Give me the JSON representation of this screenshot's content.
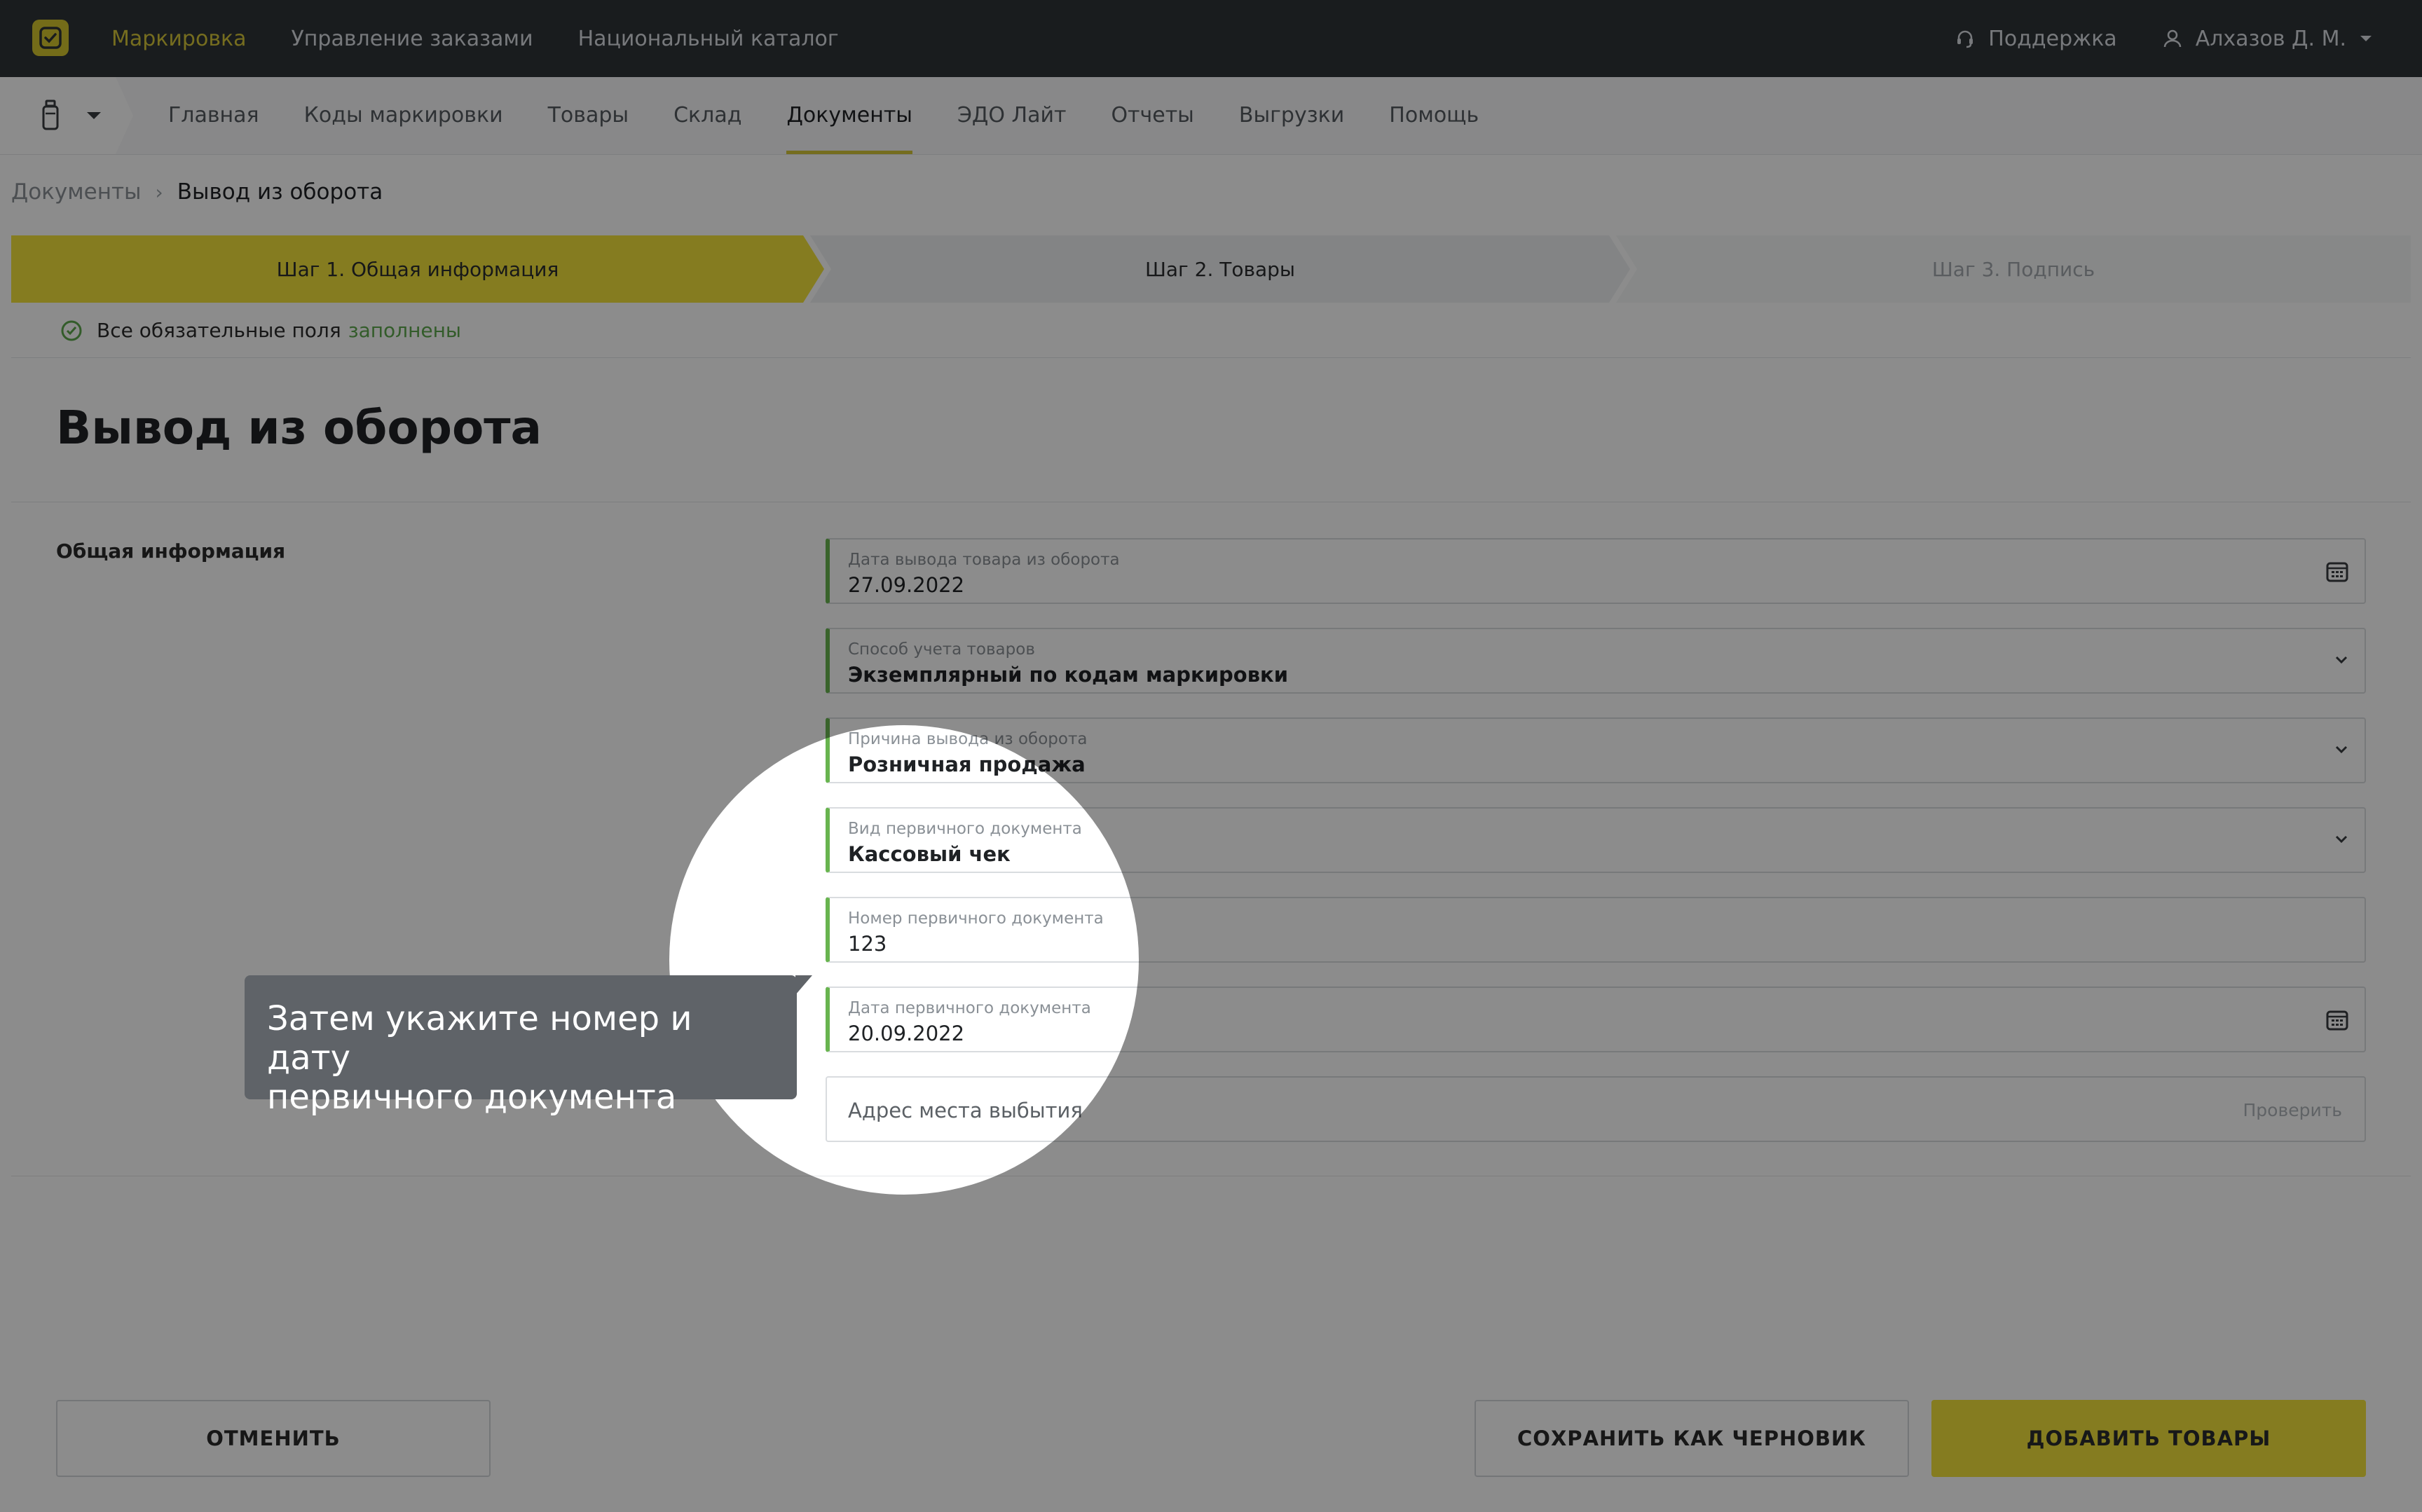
{
  "topbar": {
    "nav": [
      "Маркировка",
      "Управление заказами",
      "Национальный каталог"
    ],
    "support_label": "Поддержка",
    "user_name": "Алхазов Д. М."
  },
  "subnav": {
    "items": [
      "Главная",
      "Коды маркировки",
      "Товары",
      "Склад",
      "Документы",
      "ЭДО Лайт",
      "Отчеты",
      "Выгрузки",
      "Помощь"
    ],
    "active": "Документы"
  },
  "breadcrumb": {
    "parent": "Документы",
    "current": "Вывод из оборота"
  },
  "steps": [
    {
      "label": "Шаг 1. Общая информация",
      "state": "active"
    },
    {
      "label": "Шаг 2. Товары",
      "state": "next"
    },
    {
      "label": "Шаг 3. Подпись",
      "state": "disabled"
    }
  ],
  "status": {
    "text": "Все обязательные поля",
    "highlight": "заполнены"
  },
  "page_title": "Вывод из оборота",
  "section_label": "Общая информация",
  "fields": [
    {
      "label": "Дата вывода товара из оборота",
      "value": "27.09.2022",
      "icon": "calendar-icon"
    },
    {
      "label": "Способ учета товаров",
      "value": "Экземплярный по кодам маркировки",
      "icon": "chevron-down-icon"
    },
    {
      "label": "Причина вывода из оборота",
      "value": "Розничная продажа",
      "icon": "chevron-down-icon"
    },
    {
      "label": "Вид первичного документа",
      "value": "Кассовый чек",
      "icon": "chevron-down-icon"
    },
    {
      "label": "Номер первичного документа",
      "value": "123"
    },
    {
      "label": "Дата первичного документа",
      "value": "20.09.2022",
      "icon": "calendar-icon"
    }
  ],
  "address": {
    "placeholder": "Адрес места выбытия",
    "action": "Проверить"
  },
  "buttons": {
    "cancel": "ОТМЕНИТЬ",
    "draft": "СОХРАНИТЬ КАК ЧЕРНОВИК",
    "add": "ДОБАВИТЬ ТОВАРЫ"
  },
  "tooltip": {
    "line1": "Затем укажите номер и дату",
    "line2": "первичного документа"
  },
  "colors": {
    "accent": "#f2e23b",
    "topbar": "#2f3338",
    "valid": "#68b44f"
  }
}
